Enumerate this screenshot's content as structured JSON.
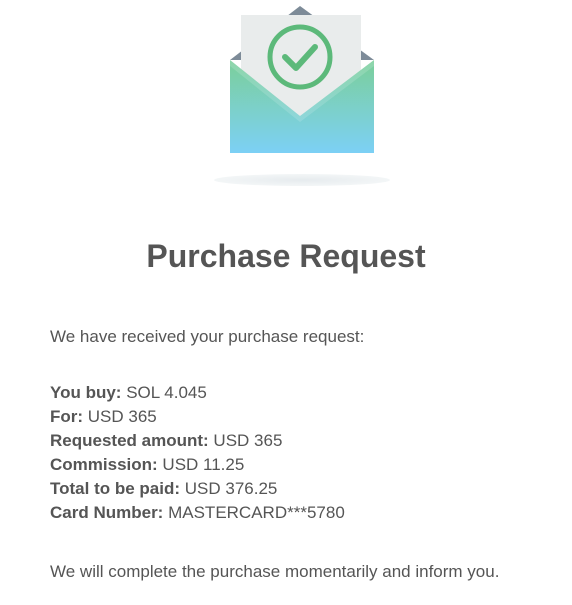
{
  "header": {
    "icon": "envelope-check-icon"
  },
  "title": "Purchase Request",
  "intro": "We have received your purchase request:",
  "details": [
    {
      "label": "You buy:",
      "value": "SOL 4.045"
    },
    {
      "label": "For:",
      "value": "USD 365"
    },
    {
      "label": "Requested amount:",
      "value": "USD 365"
    },
    {
      "label": "Commission:",
      "value": "USD 11.25"
    },
    {
      "label": "Total to be paid:",
      "value": "USD 376.25"
    },
    {
      "label": "Card Number:",
      "value": "MASTERCARD***5780"
    }
  ],
  "outro": "We will complete the purchase momentarily and inform you.",
  "colors": {
    "text": "#555555",
    "envelope_top": "#7bcf9a",
    "envelope_bottom": "#7cd0f5",
    "check": "#5cb97a"
  }
}
